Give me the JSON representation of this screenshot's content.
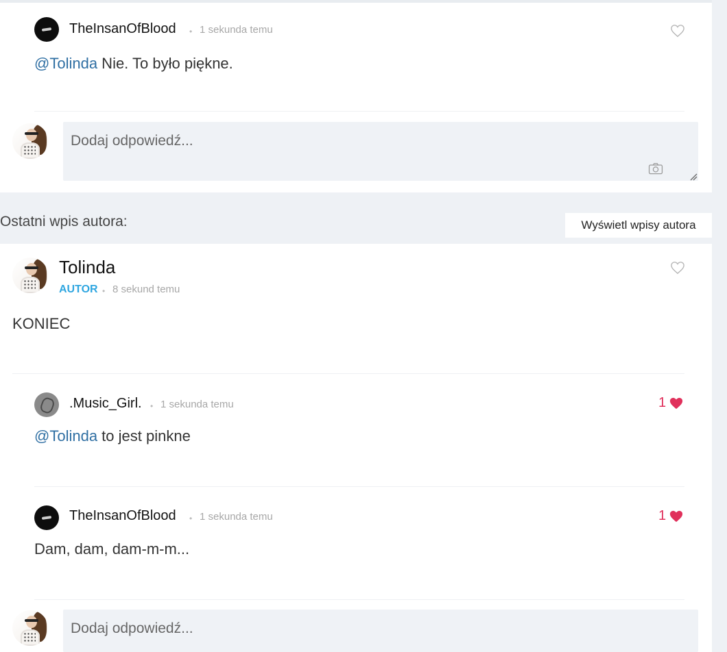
{
  "thread1": {
    "comment": {
      "author": "TheInsanOfBlood",
      "separator": "•",
      "time": "1 sekunda temu",
      "mention": "@Tolinda",
      "text": " Nie. To było piękne."
    },
    "reply_placeholder": "Dodaj odpowiedź..."
  },
  "section": {
    "label": "Ostatni wpis autora:",
    "view_button": "Wyświetl wpisy autora"
  },
  "post": {
    "author": "Tolinda",
    "badge": "AUTOR",
    "separator": "•",
    "time": "8 sekund temu",
    "body": "KONIEC"
  },
  "comments": [
    {
      "author": ".Music_Girl.",
      "separator": "•",
      "time": "1 sekunda temu",
      "mention": "@Tolinda",
      "text": " to jest pinkne",
      "likes": "1"
    },
    {
      "author": "TheInsanOfBlood",
      "separator": "•",
      "time": "1 sekunda temu",
      "mention": "",
      "text": "Dam, dam, dam-m-m...",
      "likes": "1"
    }
  ],
  "reply_placeholder": "Dodaj odpowiedź...",
  "colors": {
    "mention": "#2f6fa3",
    "like": "#e0305b",
    "badge": "#2fa6e0"
  },
  "icons": {
    "like_empty": "heart-outline-icon",
    "like_filled": "heart-filled-icon",
    "camera": "camera-icon",
    "resize": "resize-handle-icon"
  }
}
